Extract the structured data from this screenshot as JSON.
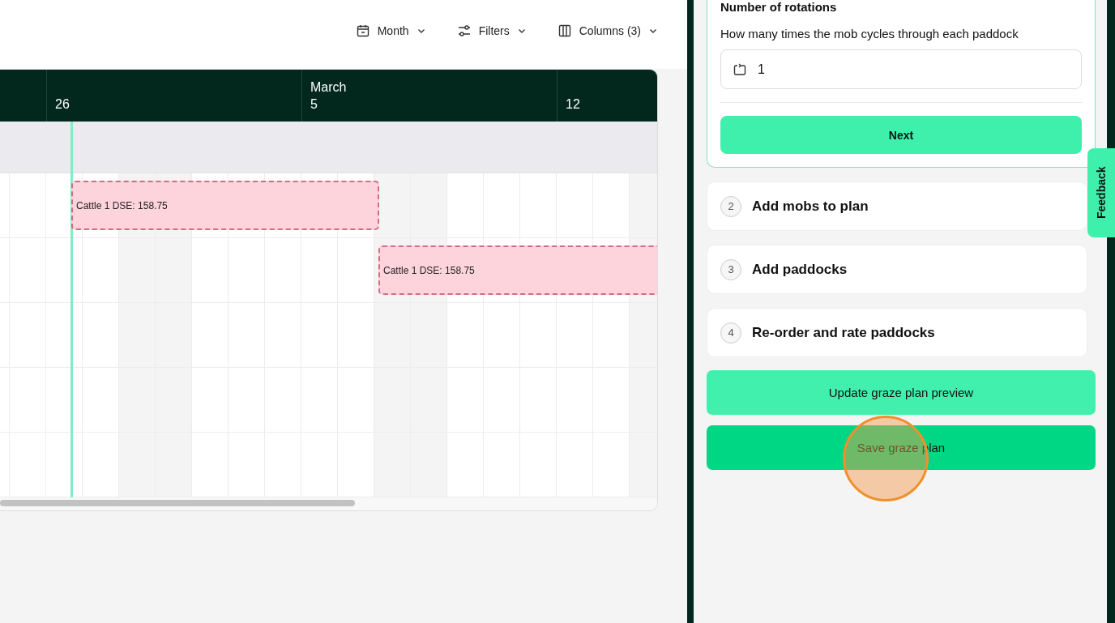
{
  "toolbar": {
    "buttons": [
      {
        "kind": "calendar",
        "label": "Month"
      },
      {
        "kind": "filters",
        "label": "Filters"
      },
      {
        "kind": "columns",
        "label": "Columns (3)"
      }
    ]
  },
  "timeline": {
    "header": [
      {
        "day": "26"
      },
      {
        "month": "March",
        "day": "5"
      },
      {
        "day": "12"
      }
    ],
    "bars": [
      {
        "label": "Cattle 1 DSE: 158.75"
      },
      {
        "label": "Cattle 1 DSE: 158.75"
      }
    ]
  },
  "rotations": {
    "label": "Number of rotations",
    "description": "How many times the mob cycles through each paddock",
    "value": "1",
    "next": "Next"
  },
  "steps": [
    {
      "number": "2",
      "title": "Add mobs to plan"
    },
    {
      "number": "3",
      "title": "Add paddocks"
    },
    {
      "number": "4",
      "title": "Re-order and rate paddocks"
    }
  ],
  "actions": [
    {
      "kind": "secondary",
      "label": "Update graze plan preview"
    },
    {
      "kind": "primary",
      "label": "Save graze plan"
    }
  ],
  "feedback": "Feedback"
}
